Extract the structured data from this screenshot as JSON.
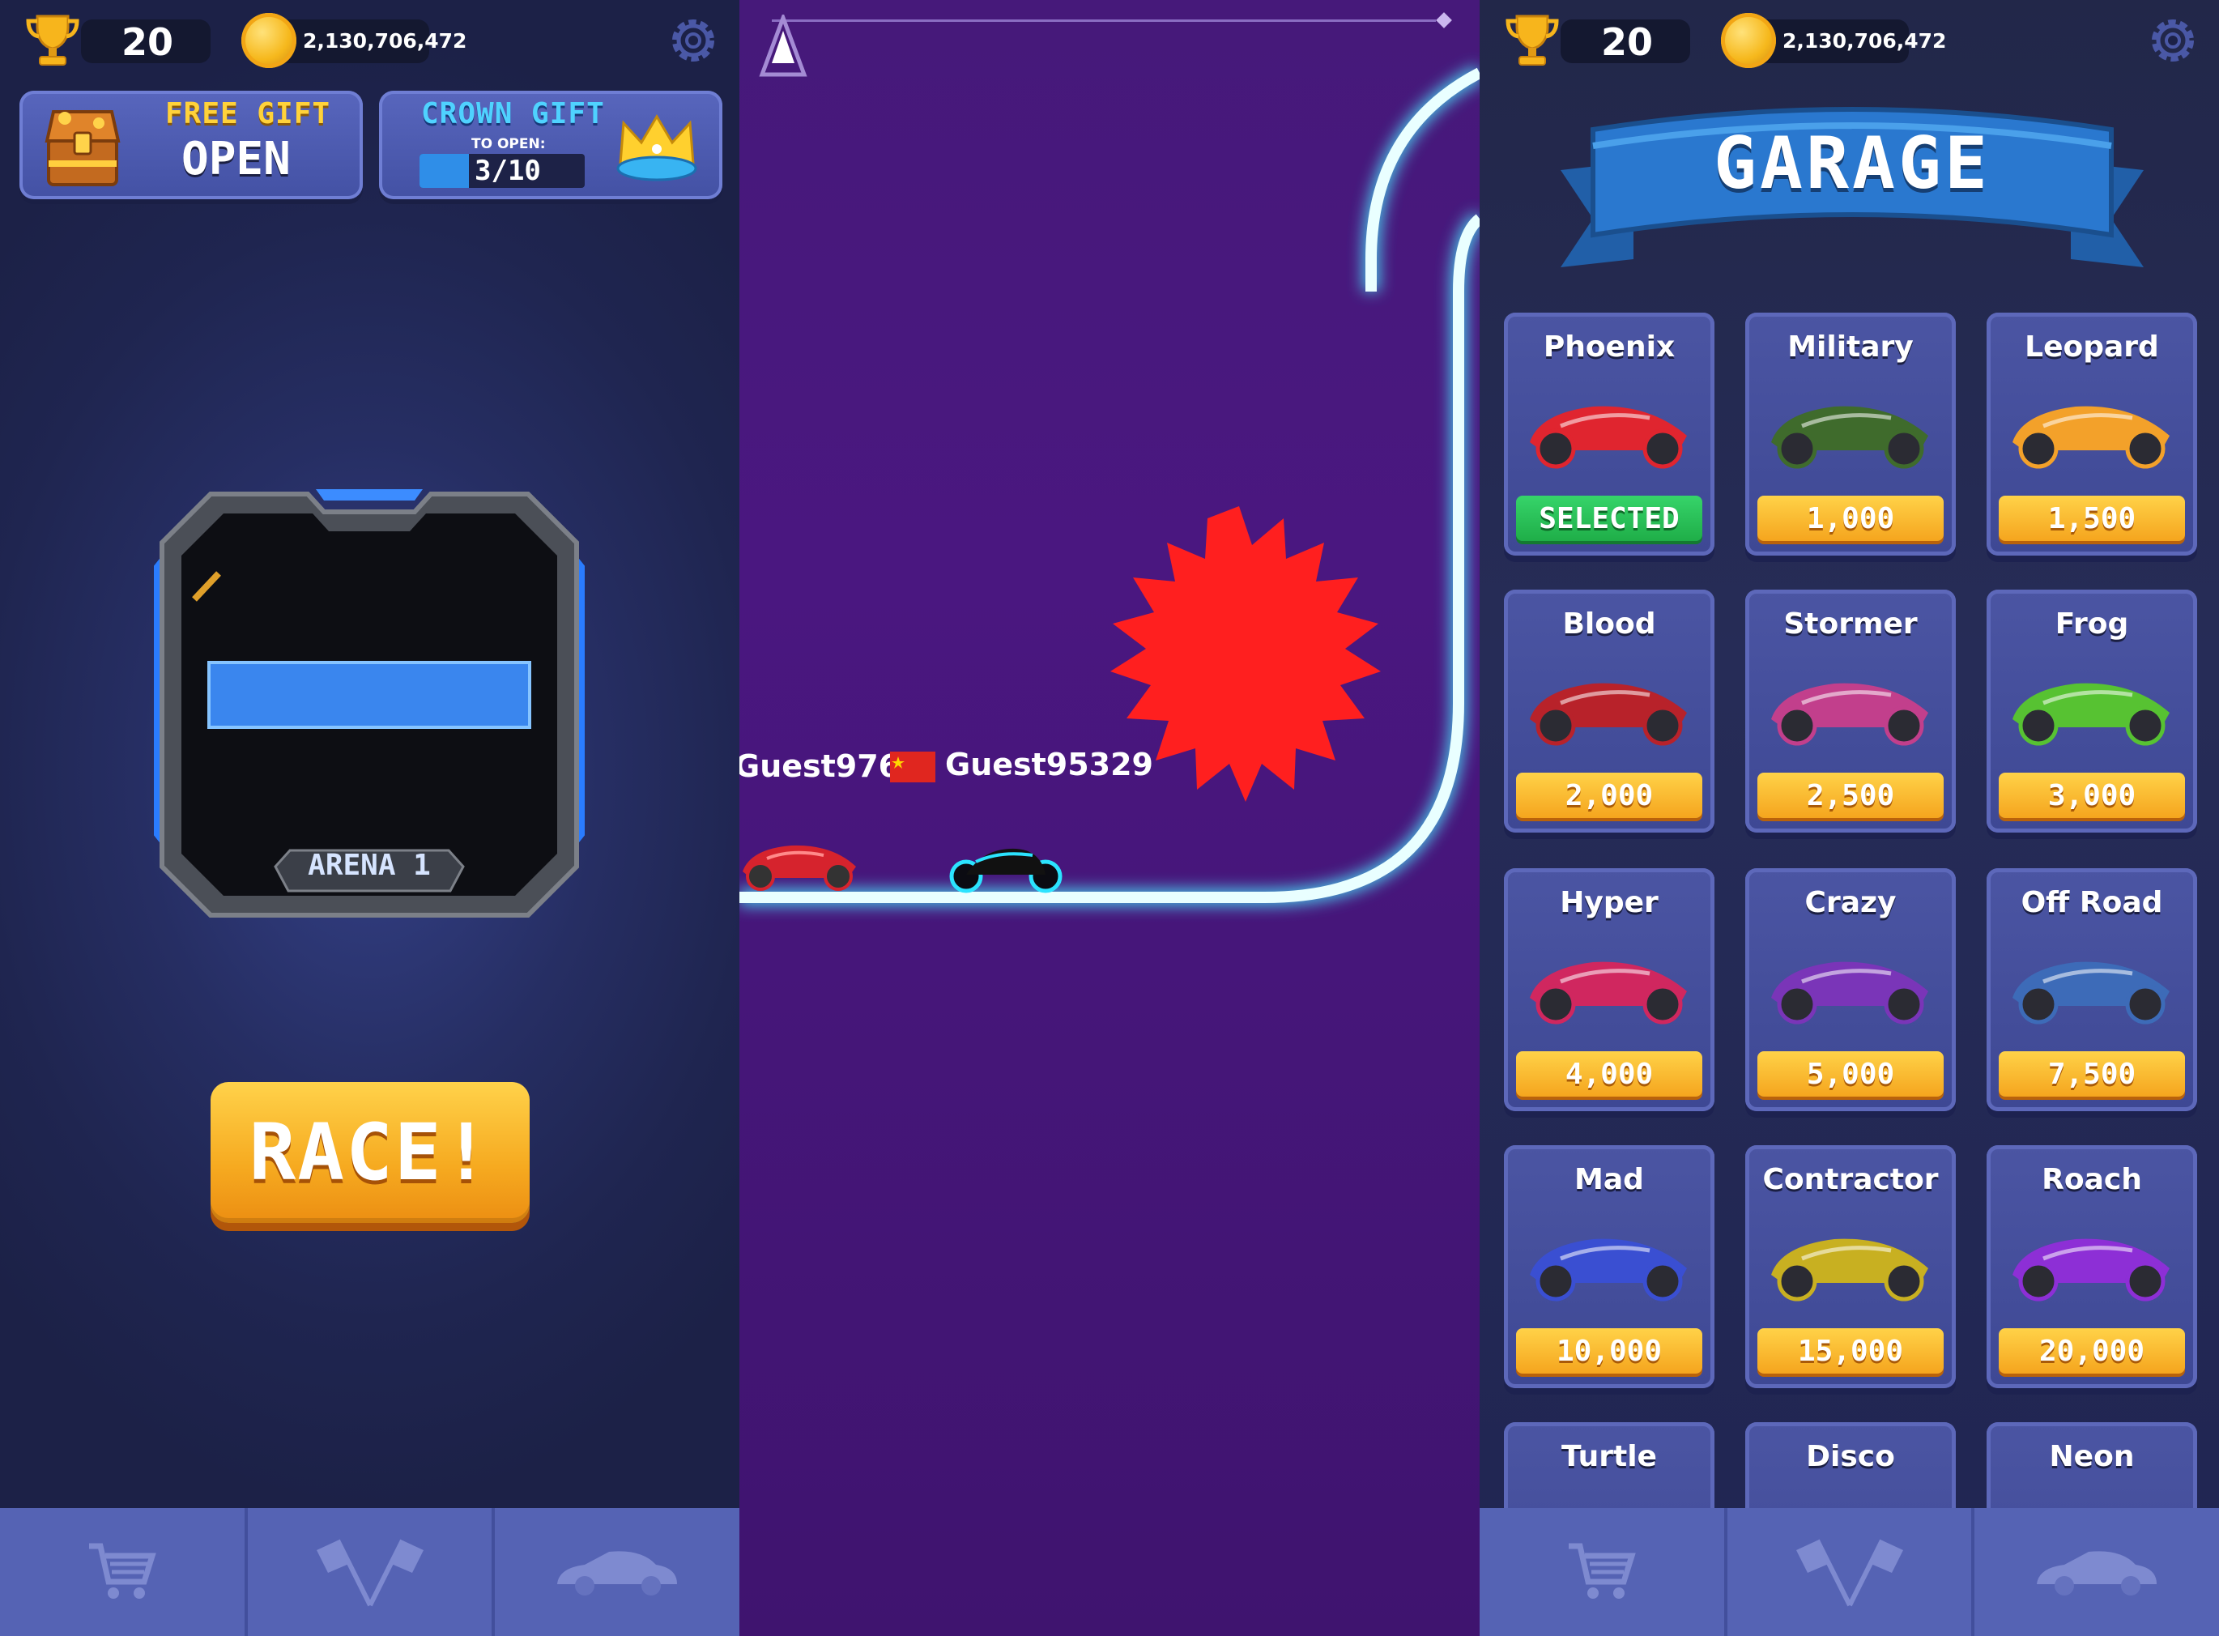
{
  "colors": {
    "accent_yellow": "#f6aa20",
    "selected_green": "#1fae48",
    "track_glow": "#7ff6ff",
    "spiky_red": "#ff2020",
    "game_purple": "#46197a",
    "nav_blue": "#5563b4"
  },
  "top_bar": {
    "trophy_icon": "trophy-icon",
    "trophies": "20",
    "coin_icon": "coin-icon",
    "coins": "2,130,706,472",
    "settings_icon": "gear-icon"
  },
  "lobby": {
    "free_gift": {
      "title": "FREE GIFT",
      "action": "OPEN",
      "icon": "treasure-chest-icon"
    },
    "crown_gift": {
      "title": "CROWN GIFT",
      "subtitle": "TO OPEN:",
      "progress_text": "3/10",
      "progress": 0.3,
      "icon": "crown-icon"
    },
    "arena_label": "ARENA 1",
    "race_button": "RACE!"
  },
  "game": {
    "progress": 0.0,
    "players": [
      {
        "name": "Guest9768",
        "flag": "china-flag-icon"
      },
      {
        "name": "Guest95329"
      }
    ]
  },
  "garage": {
    "title": "GARAGE",
    "cars": [
      {
        "name": "Phoenix",
        "price": "SELECTED",
        "selected": true,
        "color": "#e0252f"
      },
      {
        "name": "Military",
        "price": "1,000",
        "color": "#3f6b2c"
      },
      {
        "name": "Leopard",
        "price": "1,500",
        "color": "#f3a12a"
      },
      {
        "name": "Blood",
        "price": "2,000",
        "color": "#b8222a"
      },
      {
        "name": "Stormer",
        "price": "2,500",
        "color": "#c23f8c"
      },
      {
        "name": "Frog",
        "price": "3,000",
        "color": "#57c232"
      },
      {
        "name": "Hyper",
        "price": "4,000",
        "color": "#d0275f"
      },
      {
        "name": "Crazy",
        "price": "5,000",
        "color": "#7a35b8"
      },
      {
        "name": "Off Road",
        "price": "7,500",
        "color": "#3d6bb8"
      },
      {
        "name": "Mad",
        "price": "10,000",
        "color": "#3a4fd2"
      },
      {
        "name": "Contractor",
        "price": "15,000",
        "color": "#c8b021"
      },
      {
        "name": "Roach",
        "price": "20,000",
        "color": "#8d2fd6"
      },
      {
        "name": "Turtle",
        "price": ""
      },
      {
        "name": "Disco",
        "price": ""
      },
      {
        "name": "Neon",
        "price": ""
      }
    ]
  },
  "nav": [
    {
      "icon": "shopping-cart-icon"
    },
    {
      "icon": "checkered-flags-icon"
    },
    {
      "icon": "car-silhouette-icon"
    }
  ]
}
